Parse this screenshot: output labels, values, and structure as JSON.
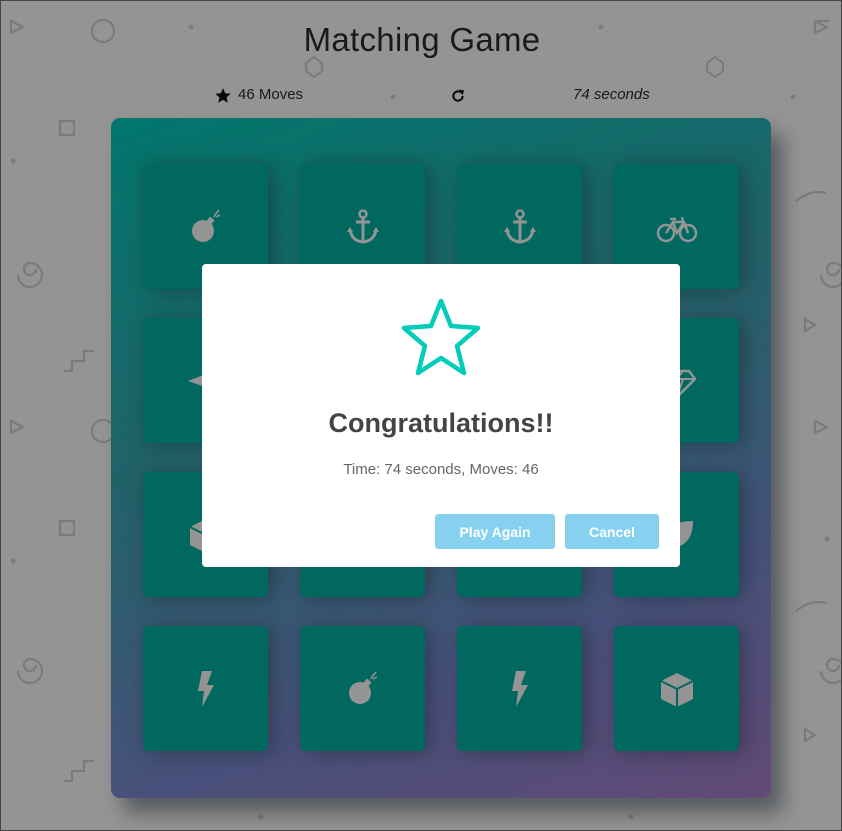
{
  "game": {
    "title": "Matching Game",
    "moves_text": "46 Moves",
    "timer_text": "74 seconds",
    "star_icon": "star-icon",
    "restart_icon": "repeat-icon"
  },
  "deck": {
    "cards": [
      {
        "icon": "bomb"
      },
      {
        "icon": "anchor"
      },
      {
        "icon": "anchor"
      },
      {
        "icon": "bicycle"
      },
      {
        "icon": "paper-plane"
      },
      {
        "icon": "hidden"
      },
      {
        "icon": "hidden"
      },
      {
        "icon": "diamond"
      },
      {
        "icon": "cube"
      },
      {
        "icon": "hidden"
      },
      {
        "icon": "hidden"
      },
      {
        "icon": "leaf"
      },
      {
        "icon": "bolt"
      },
      {
        "icon": "bomb"
      },
      {
        "icon": "bolt"
      },
      {
        "icon": "cube"
      }
    ],
    "card_color": "#02b3a4",
    "gradient_start": "#02ccba",
    "gradient_end": "#aa7ecd"
  },
  "modal": {
    "title": "Congratulations!!",
    "stats_text": "Time: 74 seconds, Moves: 46",
    "play_again_label": "Play Again",
    "cancel_label": "Cancel",
    "button_color": "#86d1f0",
    "star_color": "#02ccba"
  }
}
